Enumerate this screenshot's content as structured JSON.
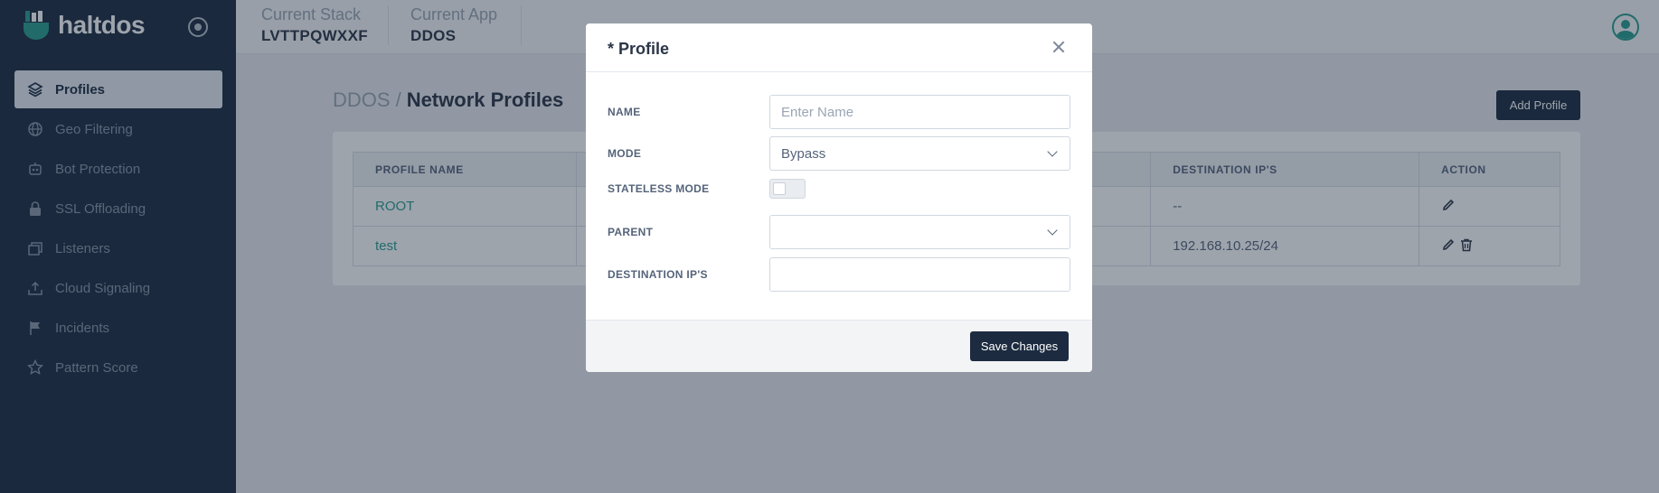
{
  "app": {
    "logo_text": "haltdos"
  },
  "sidebar": {
    "items": [
      {
        "label": "Profiles",
        "icon": "layers-icon",
        "active": true
      },
      {
        "label": "Geo Filtering",
        "icon": "globe-icon"
      },
      {
        "label": "Bot Protection",
        "icon": "robot-icon"
      },
      {
        "label": "SSL Offloading",
        "icon": "lock-icon"
      },
      {
        "label": "Listeners",
        "icon": "windows-icon"
      },
      {
        "label": "Cloud Signaling",
        "icon": "upload-icon"
      },
      {
        "label": "Incidents",
        "icon": "flag-icon"
      },
      {
        "label": "Pattern Score",
        "icon": "star-icon"
      }
    ]
  },
  "header": {
    "stack_label": "Current Stack",
    "stack_value": "LVTTPQWXXF",
    "app_label": "Current App",
    "app_value": "DDOS"
  },
  "main": {
    "breadcrumb_app": "DDOS",
    "breadcrumb_sep": "/",
    "page_title": "Network Profiles",
    "add_button": "Add Profile",
    "table": {
      "headers": [
        "PROFILE NAME",
        "DESTINATION IP'S",
        "ACTION"
      ],
      "rows": [
        {
          "name": "ROOT",
          "dest": "--"
        },
        {
          "name": "test",
          "dest": "192.168.10.25/24"
        }
      ]
    }
  },
  "modal": {
    "title": "* Profile",
    "fields": {
      "name_label": "NAME",
      "name_placeholder": "Enter Name",
      "mode_label": "MODE",
      "mode_value": "Bypass",
      "stateless_label": "STATELESS MODE",
      "stateless_on": false,
      "parent_label": "PARENT",
      "parent_value": "",
      "dest_label": "DESTINATION IP'S",
      "dest_value": ""
    },
    "save_label": "Save Changes"
  },
  "colors": {
    "sidebar_bg": "#1c2b40",
    "accent": "#2a9d8f",
    "primary_button": "#1c2b40"
  }
}
